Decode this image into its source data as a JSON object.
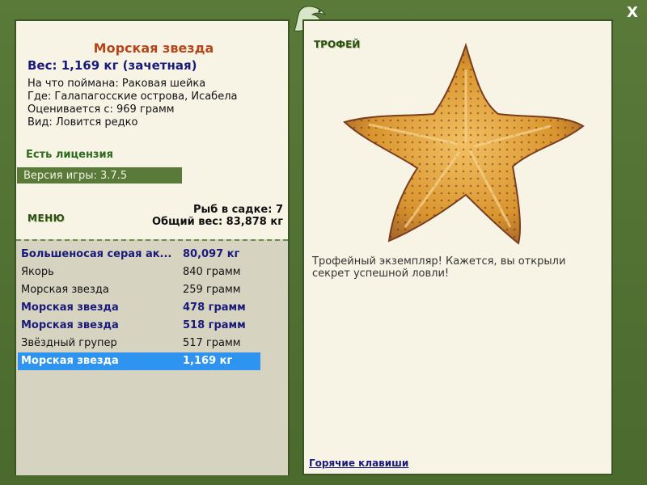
{
  "fish": {
    "name": "Морская звезда",
    "weight_line": "Вес: 1,169 кг (зачетная)",
    "caught_with": "На что поймана: Раковая шейка",
    "location": "Где: Галапагосские острова, Исабела",
    "rated_from": "Оценивается с: 969 грамм",
    "rarity": "Вид: Ловится редко"
  },
  "license": "Есть лицензия",
  "version": "Версия игры: 3.7.5",
  "menu_label": "МЕНЮ",
  "stats": {
    "fish_count": "Рыб в садке: 7",
    "total_weight": "Общий вес: 83,878 кг"
  },
  "catch_list": [
    {
      "name": "Большеносая серая ак...",
      "weight": "80,097 кг",
      "style": "bold"
    },
    {
      "name": "Якорь",
      "weight": "840 грамм",
      "style": "normal"
    },
    {
      "name": "Морская звезда",
      "weight": "259 грамм",
      "style": "normal"
    },
    {
      "name": "Морская звезда",
      "weight": "478 грамм",
      "style": "bold"
    },
    {
      "name": "Морская звезда",
      "weight": "518 грамм",
      "style": "bold"
    },
    {
      "name": "Звёздный групер",
      "weight": "517 грамм",
      "style": "normal"
    },
    {
      "name": "Морская звезда",
      "weight": "1,169 кг",
      "style": "selected"
    }
  ],
  "trophy_label": "ТРОФЕЙ",
  "trophy_text": "Трофейный экземпляр! Кажется, вы открыли секрет успешной ловли!",
  "hotkeys": "Горячие клавиши",
  "close_label": "X",
  "icons": {
    "close": "close-icon",
    "logo": "lizard-logo-icon"
  },
  "colors": {
    "frame": "#4f6d35",
    "panel": "#f7f4e6",
    "selected": "#2f93f0",
    "title": "#b5461a",
    "accent_text": "#1a1a7a"
  }
}
